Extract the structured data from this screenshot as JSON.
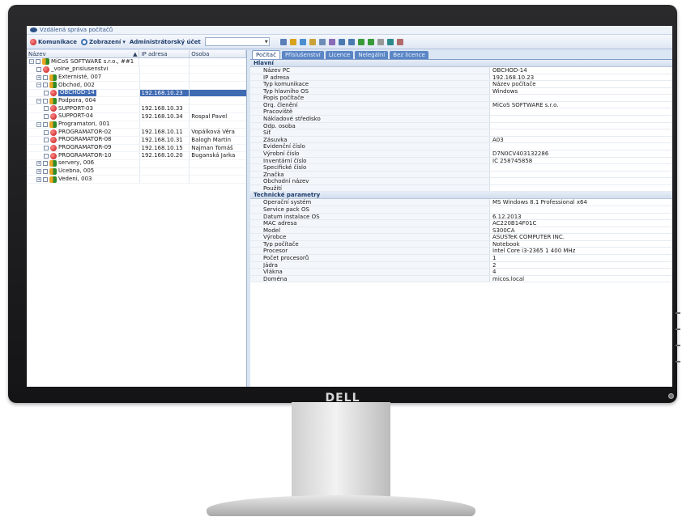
{
  "window": {
    "title": "Vzdálená správa počítačů"
  },
  "menu": {
    "komunikace": "Komunikace",
    "zobrazeni": "Zobrazení",
    "dropdown_caret": "▾",
    "account": "Administrátorský účet",
    "combo_value": ""
  },
  "tree": {
    "headers": {
      "name": "Název",
      "ip": "IP adresa",
      "person": "Osoba",
      "sort_indicator": "▲"
    },
    "rows": [
      {
        "name": "MiCoS SOFTWARE s.r.o., ##1",
        "ip": "",
        "person": "",
        "icon": "group-icon",
        "level": 0,
        "expander": "−"
      },
      {
        "name": "_volne_prislusenstvi",
        "ip": "",
        "person": "",
        "icon": "computer-red-icon",
        "level": 1,
        "expander": ""
      },
      {
        "name": "Externisté, 007",
        "ip": "",
        "person": "",
        "icon": "group-icon",
        "level": 1,
        "expander": "+"
      },
      {
        "name": "Obchod, 002",
        "ip": "",
        "person": "",
        "icon": "group-icon",
        "level": 1,
        "expander": "−"
      },
      {
        "name": "OBCHOD-14",
        "ip": "192.168.10.23",
        "person": "",
        "icon": "computer-red-icon",
        "level": 2,
        "expander": "",
        "selected": true
      },
      {
        "name": "Podpora, 004",
        "ip": "",
        "person": "",
        "icon": "group-icon",
        "level": 1,
        "expander": "−"
      },
      {
        "name": "SUPPORT-03",
        "ip": "192.168.10.33",
        "person": "",
        "icon": "computer-red-icon",
        "level": 2,
        "expander": ""
      },
      {
        "name": "SUPPORT-04",
        "ip": "192.168.10.34",
        "person": "Rospal Pavel",
        "icon": "computer-red-icon",
        "level": 2,
        "expander": ""
      },
      {
        "name": "Programatori, 001",
        "ip": "",
        "person": "",
        "icon": "group-icon",
        "level": 1,
        "expander": "−"
      },
      {
        "name": "PROGRAMATOR-02",
        "ip": "192.168.10.11",
        "person": "Vopálková Věra",
        "icon": "computer-red-icon",
        "level": 2,
        "expander": ""
      },
      {
        "name": "PROGRAMATOR-08",
        "ip": "192.168.10.31",
        "person": "Balogh Martin",
        "icon": "computer-red-icon",
        "level": 2,
        "expander": ""
      },
      {
        "name": "PROGRAMATOR-09",
        "ip": "192.168.10.15",
        "person": "Najman Tomáš",
        "icon": "computer-red-icon",
        "level": 2,
        "expander": ""
      },
      {
        "name": "PROGRAMATOR-10",
        "ip": "192.168.10.20",
        "person": "Buganská Jarka",
        "icon": "computer-red-icon",
        "level": 2,
        "expander": ""
      },
      {
        "name": "servery, 006",
        "ip": "",
        "person": "",
        "icon": "group-icon",
        "level": 1,
        "expander": "+"
      },
      {
        "name": "Ucebna, 005",
        "ip": "",
        "person": "",
        "icon": "group-icon",
        "level": 1,
        "expander": "+"
      },
      {
        "name": "Vedeni, 003",
        "ip": "",
        "person": "",
        "icon": "group-icon",
        "level": 1,
        "expander": "+"
      }
    ]
  },
  "tabs": [
    "Počítač",
    "Příslušenství",
    "Licence",
    "Nelegální",
    "Bez licence"
  ],
  "sections": [
    {
      "title": "Hlavní",
      "rows": [
        {
          "key": "Název PC",
          "value": "OBCHOD-14"
        },
        {
          "key": "IP adresa",
          "value": "192.168.10.23"
        },
        {
          "key": "Typ komunikace",
          "value": "Název počítače"
        },
        {
          "key": "Typ hlavního OS",
          "value": "Windows"
        },
        {
          "key": "Popis počítače",
          "value": ""
        },
        {
          "key": "Org. členění",
          "value": "MiCoS SOFTWARE s.r.o."
        },
        {
          "key": "Pracoviště",
          "value": ""
        },
        {
          "key": "Nákladové středisko",
          "value": ""
        },
        {
          "key": "Odp. osoba",
          "value": ""
        },
        {
          "key": "Síť",
          "value": ""
        },
        {
          "key": "Zásuvka",
          "value": "A03"
        },
        {
          "key": "Evidenční číslo",
          "value": ""
        },
        {
          "key": "Výrobní číslo",
          "value": "D7N0CV403132286"
        },
        {
          "key": "Inventární číslo",
          "value": "IČ 258745858"
        },
        {
          "key": "Specifické číslo",
          "value": ""
        },
        {
          "key": "Značka",
          "value": ""
        },
        {
          "key": "Obchodní název",
          "value": ""
        },
        {
          "key": "Použití",
          "value": ""
        }
      ]
    },
    {
      "title": "Technické parametry",
      "rows": [
        {
          "key": "Operační systém",
          "value": "MS Windows 8.1 Professional x64"
        },
        {
          "key": "Service pack OS",
          "value": ""
        },
        {
          "key": "Datum instalace OS",
          "value": "6.12.2013"
        },
        {
          "key": "MAC adresa",
          "value": "AC220B14F01C"
        },
        {
          "key": "Model",
          "value": "S300CA"
        },
        {
          "key": "Výrobce",
          "value": "ASUSTeK COMPUTER INC."
        },
        {
          "key": "Typ počítače",
          "value": "Notebook"
        },
        {
          "key": "Procesor",
          "value": "Intel Core i3-2365  1 400 MHz"
        },
        {
          "key": "Počet procesorů",
          "value": "1"
        },
        {
          "key": "Jádra",
          "value": "2"
        },
        {
          "key": "Vlákna",
          "value": "4"
        },
        {
          "key": "Doména",
          "value": "micos.local"
        }
      ]
    }
  ],
  "monitor": {
    "brand": "DELL"
  },
  "colors": {
    "accent": "#3f6bb3",
    "bezel": "#1c1c1e",
    "tab_inactive": "#5b86c6"
  },
  "toolbar_icons": [
    "monitor-icon",
    "lightbulb-icon",
    "network-icon",
    "folder-icon",
    "document-icon",
    "chart-icon",
    "screen-icon",
    "capture-icon",
    "connect-icon",
    "refresh-icon",
    "gear-icon",
    "power-icon",
    "grid-icon"
  ]
}
